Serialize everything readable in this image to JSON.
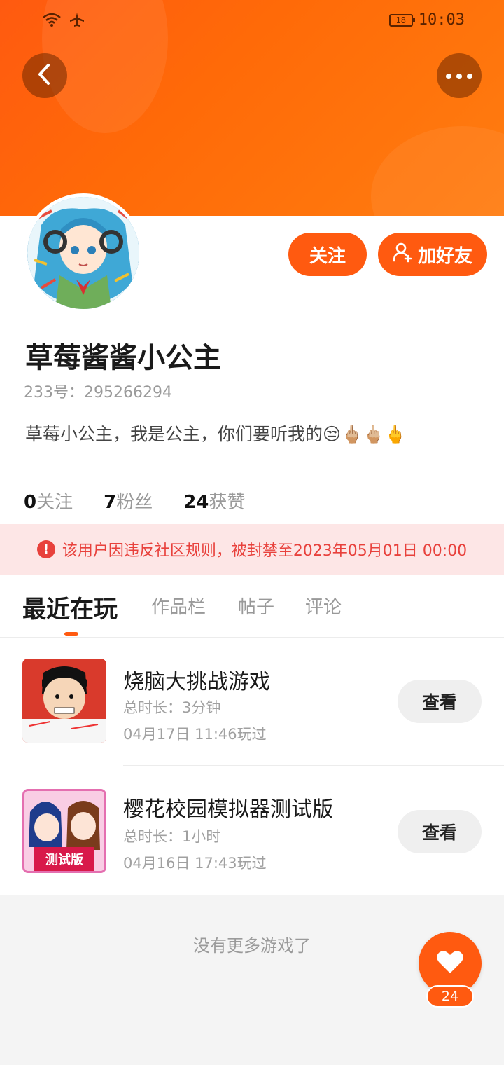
{
  "status_bar": {
    "battery": "18",
    "time": "10:03"
  },
  "profile": {
    "follow_label": "关注",
    "add_friend_label": "加好友",
    "username": "草莓酱酱小公主",
    "uid_label": "233号：",
    "uid_value": "295266294",
    "bio": "草莓小公主，我是公主，你们要听我的😒🖕🏼🖕🏼🖕",
    "stats": [
      {
        "num": "0",
        "label": "关注"
      },
      {
        "num": "7",
        "label": "粉丝"
      },
      {
        "num": "24",
        "label": "获赞"
      }
    ]
  },
  "notice": {
    "text": "该用户因违反社区规则，被封禁至2023年05月01日 00:00",
    "color": "#e8413c"
  },
  "tabs": [
    {
      "label": "最近在玩",
      "active": true
    },
    {
      "label": "作品栏"
    },
    {
      "label": "帖子"
    },
    {
      "label": "评论"
    }
  ],
  "games": [
    {
      "name": "烧脑大挑战游戏",
      "duration": "总时长：3分钟",
      "played": "04月17日 11:46玩过",
      "view_label": "查看"
    },
    {
      "name": "樱花校园模拟器测试版",
      "duration": "总时长：1小时",
      "played": "04月16日 17:43玩过",
      "view_label": "查看",
      "icon_badge": "测试版"
    }
  ],
  "no_more_text": "没有更多游戏了",
  "like": {
    "count": "24"
  },
  "colors": {
    "accent": "#ff5a10",
    "notice_bg": "#fde6e6"
  }
}
